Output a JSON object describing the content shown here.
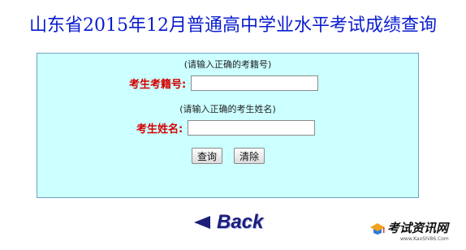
{
  "page": {
    "title": "山东省2015年12月普通高中学业水平考试成绩查询"
  },
  "form": {
    "exam_id_hint": "(请输入正确的考籍号)",
    "exam_id_label": "考生考籍号:",
    "exam_id_value": "",
    "name_hint": "(请输入正确的考生姓名)",
    "name_label": "考生姓名:",
    "name_value": "",
    "query_button": "查询",
    "clear_button": "清除"
  },
  "nav": {
    "back_label": "Back",
    "back_icon": "left-triangle-arrow-icon"
  },
  "watermark": {
    "name": "考试资讯网",
    "url": "www.KaoShi86.Com"
  },
  "colors": {
    "title": "#0a1ccf",
    "label": "#d40000",
    "panel_bg": "#ccffff",
    "back": "#1b1f7a"
  }
}
